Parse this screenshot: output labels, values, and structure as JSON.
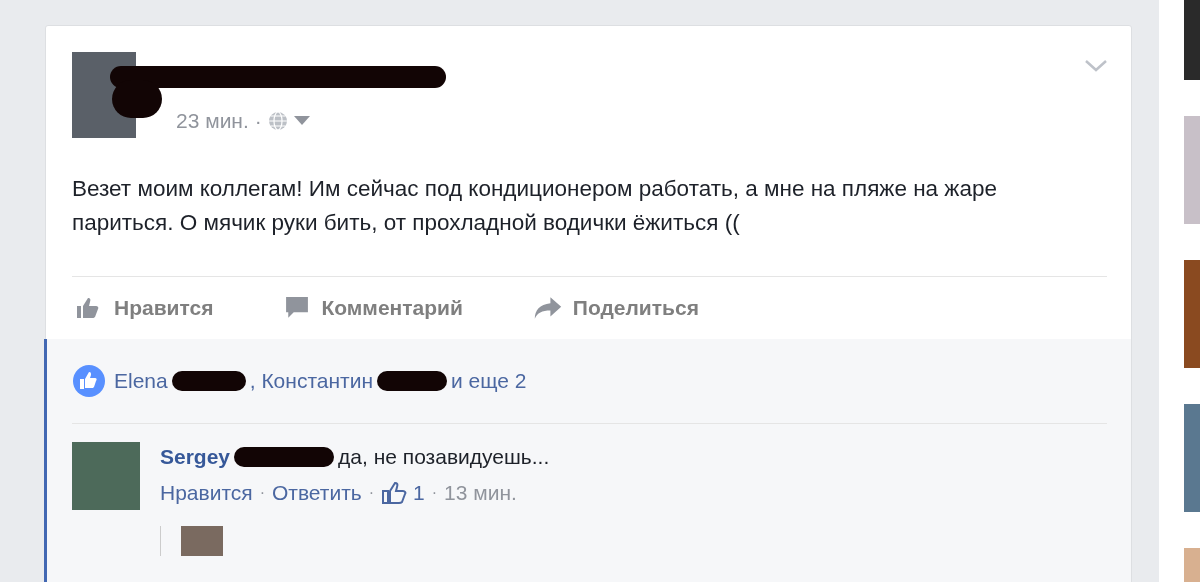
{
  "post": {
    "time": "23 мин.",
    "separator": "·",
    "text": "Везет моим коллегам! Им сейчас под кондиционером работать, а мне на пляже на жаре париться. О мячик руки бить, от прохладной водички ёжиться ((",
    "actions": [
      {
        "kind": "like",
        "label": "Нравится"
      },
      {
        "kind": "comment",
        "label": "Комментарий"
      },
      {
        "kind": "share",
        "label": "Поделиться"
      }
    ]
  },
  "likes": {
    "parts": [
      {
        "kind": "text",
        "text": "Elena"
      },
      {
        "kind": "redacted"
      },
      {
        "kind": "text",
        "text": ", Константин"
      },
      {
        "kind": "redacted"
      },
      {
        "kind": "text",
        "text": "и еще 2"
      }
    ]
  },
  "comment": {
    "author": "Sergey",
    "text": "да, не позавидуешь...",
    "separator": "·",
    "actions": [
      "Нравится",
      "Ответить"
    ],
    "like_count": "1",
    "time": "13 мин."
  }
}
